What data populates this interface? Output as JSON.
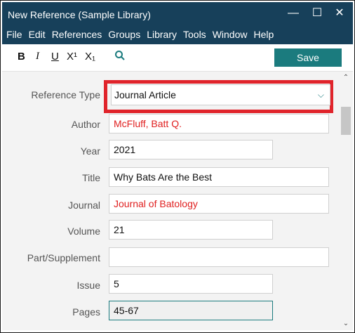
{
  "window": {
    "title": "New Reference (Sample Library)",
    "controls": {
      "minimize": "—",
      "maximize": "☐",
      "close": "✕"
    }
  },
  "menu": [
    "File",
    "Edit",
    "References",
    "Groups",
    "Library",
    "Tools",
    "Window",
    "Help"
  ],
  "toolbar": {
    "bold": "B",
    "italic": "I",
    "underline": "U",
    "superscript": "X¹",
    "subscript": "X₁",
    "search_icon": "search-icon",
    "save_label": "Save",
    "accent_color": "#1b7b7e"
  },
  "form": {
    "reference_type": {
      "label": "Reference Type",
      "value": "Journal Article"
    },
    "author": {
      "label": "Author",
      "value": "McFluff, Batt Q."
    },
    "year": {
      "label": "Year",
      "value": "2021"
    },
    "title": {
      "label": "Title",
      "value": "Why Bats Are the Best"
    },
    "journal": {
      "label": "Journal",
      "value": "Journal of Batology"
    },
    "volume": {
      "label": "Volume",
      "value": "21"
    },
    "part": {
      "label": "Part/Supplement",
      "value": ""
    },
    "issue": {
      "label": "Issue",
      "value": "5"
    },
    "pages": {
      "label": "Pages",
      "value": "45-67"
    }
  },
  "colors": {
    "titlebar": "#17405a",
    "highlight": "#e0242b",
    "red_text": "#e02020"
  }
}
